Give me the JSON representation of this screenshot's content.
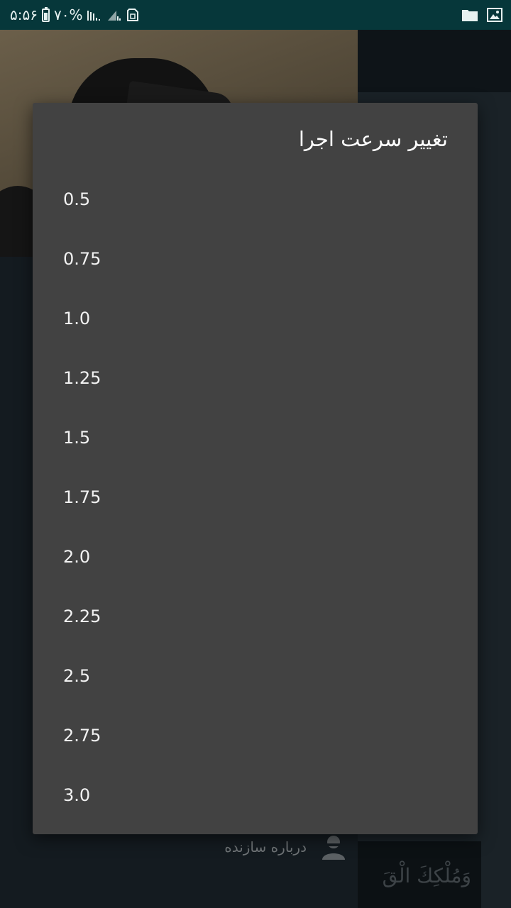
{
  "status_bar": {
    "time": "۵:۵۶",
    "battery_percent": "۷۰%",
    "icons": [
      "battery-icon",
      "signal-icon",
      "signal-icon",
      "sim-icon",
      "folder-icon",
      "image-icon"
    ]
  },
  "dialog": {
    "title": "تغییر سرعت اجرا",
    "options": [
      {
        "label": "0.5"
      },
      {
        "label": "0.75"
      },
      {
        "label": "1.0"
      },
      {
        "label": "1.25"
      },
      {
        "label": "1.5"
      },
      {
        "label": "1.75"
      },
      {
        "label": "2.0"
      },
      {
        "label": "2.25"
      },
      {
        "label": "2.5"
      },
      {
        "label": "2.75"
      },
      {
        "label": "3.0"
      }
    ]
  },
  "background": {
    "drawer_item_label": "درباره سازنده",
    "verse_text": "وَمُلْكِكَ الْقَ"
  },
  "colors": {
    "status_bar": "#06373a",
    "dialog_background": "#424242",
    "dialog_text": "#ffffff"
  }
}
